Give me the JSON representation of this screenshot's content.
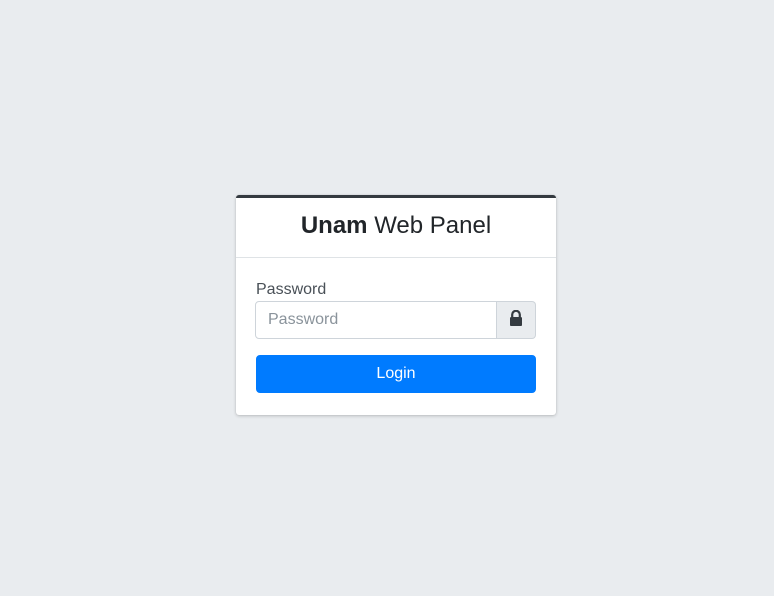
{
  "header": {
    "brand_bold": "Unam",
    "brand_rest": "Web Panel"
  },
  "form": {
    "password_label": "Password",
    "password_placeholder": "Password",
    "password_value": "",
    "lock_icon": "lock-icon",
    "login_label": "Login"
  },
  "colors": {
    "background": "#e9ecef",
    "card_top_border": "#343a40",
    "primary": "#007bff"
  }
}
